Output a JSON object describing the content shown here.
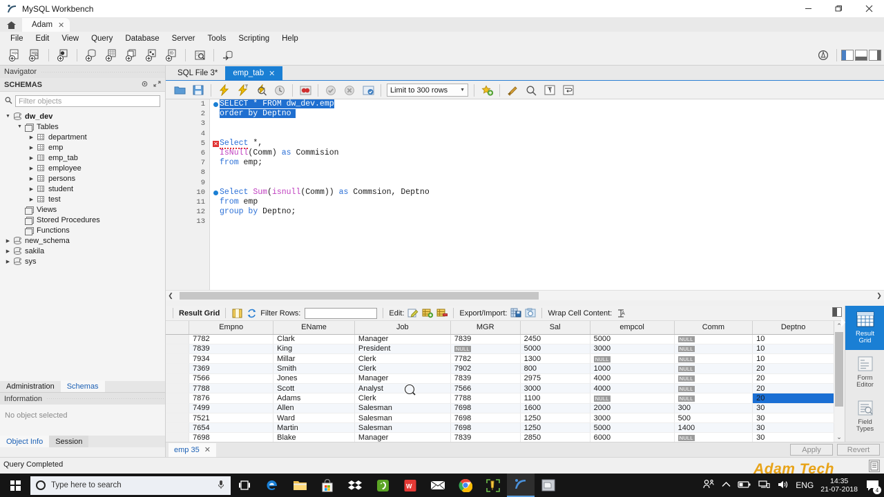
{
  "window": {
    "title": "MySQL Workbench",
    "minimize": "—",
    "maximize": "❐",
    "close": "✕"
  },
  "connection_tabs": [
    {
      "label": "Adam",
      "close": "✕"
    }
  ],
  "menubar": [
    "File",
    "Edit",
    "View",
    "Query",
    "Database",
    "Server",
    "Tools",
    "Scripting",
    "Help"
  ],
  "navigator": {
    "header": "Navigator",
    "schemas_label": "SCHEMAS",
    "filter_placeholder": "Filter objects",
    "tree": [
      {
        "label": "dw_dev",
        "indent": 0,
        "arrow": "▼",
        "icon": "database-icon",
        "bold": true
      },
      {
        "label": "Tables",
        "indent": 1,
        "arrow": "▼",
        "icon": "folder-icon",
        "bold": false
      },
      {
        "label": "department",
        "indent": 2,
        "arrow": "▶",
        "icon": "table-icon",
        "bold": false
      },
      {
        "label": "emp",
        "indent": 2,
        "arrow": "▶",
        "icon": "table-icon",
        "bold": false
      },
      {
        "label": "emp_tab",
        "indent": 2,
        "arrow": "▶",
        "icon": "table-icon",
        "bold": false
      },
      {
        "label": "employee",
        "indent": 2,
        "arrow": "▶",
        "icon": "table-icon",
        "bold": false
      },
      {
        "label": "persons",
        "indent": 2,
        "arrow": "▶",
        "icon": "table-icon",
        "bold": false
      },
      {
        "label": "student",
        "indent": 2,
        "arrow": "▶",
        "icon": "table-icon",
        "bold": false
      },
      {
        "label": "test",
        "indent": 2,
        "arrow": "▶",
        "icon": "table-icon",
        "bold": false
      },
      {
        "label": "Views",
        "indent": 1,
        "arrow": "",
        "icon": "folder-icon",
        "bold": false
      },
      {
        "label": "Stored Procedures",
        "indent": 1,
        "arrow": "",
        "icon": "folder-icon",
        "bold": false
      },
      {
        "label": "Functions",
        "indent": 1,
        "arrow": "",
        "icon": "folder-icon",
        "bold": false
      },
      {
        "label": "new_schema",
        "indent": 0,
        "arrow": "▶",
        "icon": "database-icon",
        "bold": false
      },
      {
        "label": "sakila",
        "indent": 0,
        "arrow": "▶",
        "icon": "database-icon",
        "bold": false
      },
      {
        "label": "sys",
        "indent": 0,
        "arrow": "▶",
        "icon": "database-icon",
        "bold": false
      }
    ]
  },
  "left_bottom": {
    "tabs": [
      {
        "label": "Administration",
        "active": false
      },
      {
        "label": "Schemas",
        "active": true
      }
    ],
    "information_header": "Information",
    "information_body": "No object selected",
    "object_tabs": [
      {
        "label": "Object Info",
        "active": true
      },
      {
        "label": "Session",
        "active": false
      }
    ]
  },
  "statusbar": {
    "text": "Query Completed"
  },
  "editor": {
    "tabs": [
      {
        "label": "SQL File 3*",
        "active": false,
        "close": ""
      },
      {
        "label": "emp_tab",
        "active": true,
        "close": "✕"
      }
    ],
    "limit_value": "Limit to 300 rows",
    "lines": [
      {
        "no": "1",
        "marker": "dot"
      },
      {
        "no": "2",
        "marker": ""
      },
      {
        "no": "3",
        "marker": ""
      },
      {
        "no": "4",
        "marker": ""
      },
      {
        "no": "5",
        "marker": "error"
      },
      {
        "no": "6",
        "marker": ""
      },
      {
        "no": "7",
        "marker": ""
      },
      {
        "no": "8",
        "marker": ""
      },
      {
        "no": "9",
        "marker": ""
      },
      {
        "no": "10",
        "marker": "dot"
      },
      {
        "no": "11",
        "marker": ""
      },
      {
        "no": "12",
        "marker": ""
      },
      {
        "no": "13",
        "marker": ""
      }
    ],
    "sql_text": [
      "SELECT * FROM dw_dev.emp",
      "order by Deptno",
      "",
      "",
      "Select *,",
      "IsNull(Comm) as Commision",
      "from emp;",
      "",
      "",
      "Select Sum(isnull(Comm)) as Commsion, Deptno",
      "from emp",
      "group by Deptno;",
      ""
    ]
  },
  "result_toolbar": {
    "result_grid_label": "Result Grid",
    "filter_rows_label": "Filter Rows:",
    "filter_rows_value": "",
    "edit_label": "Edit:",
    "export_import_label": "Export/Import:",
    "wrap_cell_label": "Wrap Cell Content:"
  },
  "grid": {
    "columns": [
      "Empno",
      "EName",
      "Job",
      "MGR",
      "Sal",
      "empcol",
      "Comm",
      "Deptno"
    ],
    "rows": [
      {
        "cells": [
          "7782",
          "Clark",
          "Manager",
          "7839",
          "2450",
          "5000",
          "NULL",
          "10"
        ],
        "selected": ""
      },
      {
        "cells": [
          "7839",
          "King",
          "President",
          "NULL",
          "5000",
          "3000",
          "NULL",
          "10"
        ],
        "selected": ""
      },
      {
        "cells": [
          "7934",
          "Millar",
          "Clerk",
          "7782",
          "1300",
          "NULL",
          "NULL",
          "10"
        ],
        "selected": ""
      },
      {
        "cells": [
          "7369",
          "Smith",
          "Clerk",
          "7902",
          "800",
          "1000",
          "NULL",
          "20"
        ],
        "selected": ""
      },
      {
        "cells": [
          "7566",
          "Jones",
          "Manager",
          "7839",
          "2975",
          "4000",
          "NULL",
          "20"
        ],
        "selected": ""
      },
      {
        "cells": [
          "7788",
          "Scott",
          "Analyst",
          "7566",
          "3000",
          "4000",
          "NULL",
          "20"
        ],
        "selected": ""
      },
      {
        "cells": [
          "7876",
          "Adams",
          "Clerk",
          "7788",
          "1100",
          "NULL",
          "NULL",
          "20"
        ],
        "selected": "Deptno"
      },
      {
        "cells": [
          "7499",
          "Allen",
          "Salesman",
          "7698",
          "1600",
          "2000",
          "300",
          "30"
        ],
        "selected": ""
      },
      {
        "cells": [
          "7521",
          "Ward",
          "Salesman",
          "7698",
          "1250",
          "3000",
          "500",
          "30"
        ],
        "selected": ""
      },
      {
        "cells": [
          "7654",
          "Martin",
          "Salesman",
          "7698",
          "1250",
          "5000",
          "1400",
          "30"
        ],
        "selected": ""
      },
      {
        "cells": [
          "7698",
          "Blake",
          "Manager",
          "7839",
          "2850",
          "6000",
          "NULL",
          "30"
        ],
        "selected": ""
      }
    ]
  },
  "side_panel": [
    {
      "label_line1": "Result",
      "label_line2": "Grid",
      "icon": "result-grid-icon",
      "active": true
    },
    {
      "label_line1": "Form",
      "label_line2": "Editor",
      "icon": "form-editor-icon",
      "active": false
    },
    {
      "label_line1": "Field",
      "label_line2": "Types",
      "icon": "field-types-icon",
      "active": false
    }
  ],
  "result_tabstrip": {
    "tabs": [
      {
        "label": "emp 35",
        "close": "✕"
      }
    ],
    "apply_label": "Apply",
    "revert_label": "Revert"
  },
  "taskbar": {
    "search_placeholder": "Type here to search",
    "language": "ENG",
    "time": "14:35",
    "date": "21-07-2018",
    "notification_count": "4"
  },
  "watermark": "Adam Tech",
  "colors": {
    "accent": "#1a7fd4",
    "selection": "#1f6fd0",
    "keyword": "#2a6fd6",
    "function": "#c040c0",
    "error": "#e03131",
    "null_badge": "#9b9b9b"
  }
}
